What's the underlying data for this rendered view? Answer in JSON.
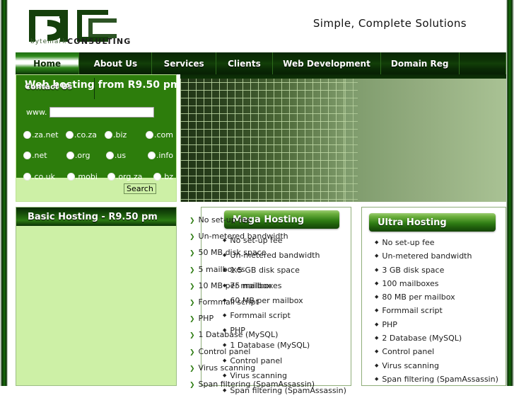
{
  "header": {
    "logo_text": "bC",
    "logo_sub": "CONSULTING",
    "logo_brand": "bytemark",
    "tagline": "Simple, Complete Solutions"
  },
  "nav": {
    "items": [
      {
        "label": "Home",
        "active": true
      },
      {
        "label": "About Us",
        "active": false
      },
      {
        "label": "Services",
        "active": false
      },
      {
        "label": "Clients",
        "active": false
      },
      {
        "label": "Web Development",
        "active": false
      },
      {
        "label": "Domain Reg",
        "active": false
      },
      {
        "label": "",
        "active": false
      }
    ],
    "overlapping_item": "Contact Us"
  },
  "domain_search": {
    "title": "Web hosting from R9.50 pm",
    "www_label": "www.",
    "input_value": "",
    "input_placeholder": "",
    "search_button": "Search",
    "tlds_row1": [
      ".za.net",
      ".co.za",
      ".biz",
      ".com"
    ],
    "tlds_row2": [
      ".net",
      ".org",
      ".us",
      ".info"
    ],
    "tlds_row3": [
      ".co.uk",
      ".mobi",
      ".org.za",
      ".bz"
    ]
  },
  "plans": {
    "basic": {
      "title": "Basic Hosting - R9.50 pm",
      "features": [
        "No set-up fee",
        "Un-metered bandwidth",
        "50 MB disk space",
        "5 mailboxes",
        "10 MB per mailbox",
        "Formmail script",
        "PHP",
        "1 Database (MySQL)",
        "Control panel",
        "Virus scanning",
        "Span filtering (SpamAssassin)"
      ]
    },
    "mega": {
      "title": "Mega Hosting",
      "features": [
        "No set-up fee",
        "Un-metered bandwidth",
        "1.5 GB disk space",
        "75 mailboxes",
        "60 MB per mailbox",
        "Formmail script",
        "PHP",
        "1 Database (MySQL)",
        "Control panel",
        "Virus scanning",
        "Span filtering (SpamAssassin)"
      ]
    },
    "ultra": {
      "title": "Ultra Hosting",
      "features": [
        "No set-up fee",
        "Un-metered bandwidth",
        "3 GB disk space",
        "100 mailboxes",
        "80 MB per mailbox",
        "Formmail script",
        "PHP",
        "2 Database (MySQL)",
        "Control panel",
        "Virus scanning",
        "Span filtering (SpamAssassin)"
      ]
    }
  },
  "colors": {
    "dark_green": "#0a2705",
    "mid_green": "#2d7d0c",
    "light_green": "#cdf0a6",
    "banner_light": "#a9c294"
  }
}
